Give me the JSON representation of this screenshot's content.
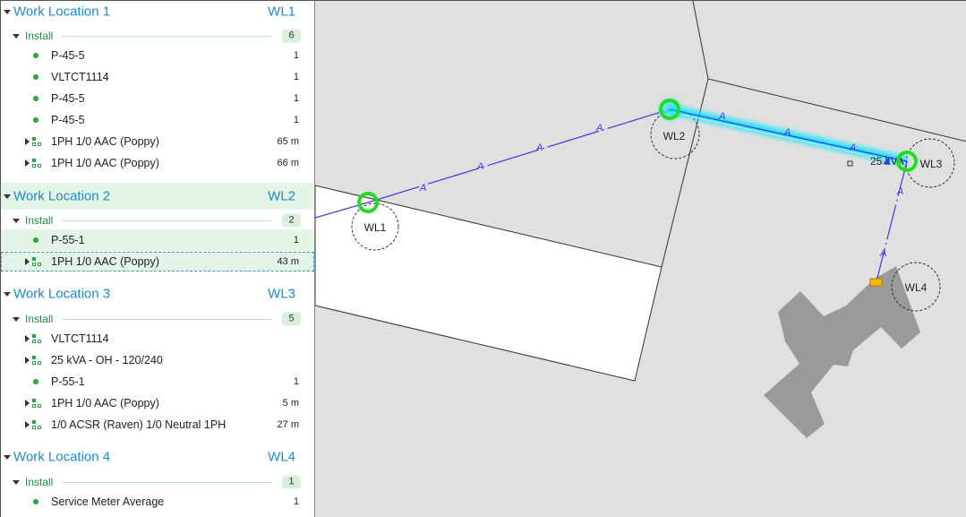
{
  "work_locations": [
    {
      "title": "Work Location 1",
      "code": "WL1",
      "install_label": "Install",
      "install_count": "6",
      "items": [
        {
          "label": "P-45-5",
          "value": "1",
          "kind": "dot"
        },
        {
          "label": "VLTCT1114",
          "value": "1",
          "kind": "dot"
        },
        {
          "label": "P-45-5",
          "value": "1",
          "kind": "dot"
        },
        {
          "label": "P-45-5",
          "value": "1",
          "kind": "dot"
        },
        {
          "label": "1PH 1/0 AAC (Poppy)",
          "value": "65 m",
          "kind": "group"
        },
        {
          "label": "1PH 1/0 AAC (Poppy)",
          "value": "66 m",
          "kind": "group"
        }
      ]
    },
    {
      "title": "Work Location 2",
      "code": "WL2",
      "install_label": "Install",
      "install_count": "2",
      "items": [
        {
          "label": "P-55-1",
          "value": "1",
          "kind": "dot"
        },
        {
          "label": "1PH 1/0 AAC (Poppy)",
          "value": "43 m",
          "kind": "group"
        }
      ]
    },
    {
      "title": "Work Location 3",
      "code": "WL3",
      "install_label": "Install",
      "install_count": "5",
      "items": [
        {
          "label": "VLTCT1114",
          "value": "",
          "kind": "group"
        },
        {
          "label": "25 kVA - OH - 120/240",
          "value": "",
          "kind": "group"
        },
        {
          "label": "P-55-1",
          "value": "1",
          "kind": "dot"
        },
        {
          "label": "1PH 1/0 AAC (Poppy)",
          "value": "5 m",
          "kind": "group"
        },
        {
          "label": "1/0 ACSR (Raven) 1/0 Neutral 1PH",
          "value": "27 m",
          "kind": "group"
        }
      ]
    },
    {
      "title": "Work Location 4",
      "code": "WL4",
      "install_label": "Install",
      "install_count": "1",
      "items": [
        {
          "label": "Service Meter Average",
          "value": "1",
          "kind": "dot"
        }
      ]
    }
  ],
  "map": {
    "wl_labels": [
      "WL1",
      "WL2",
      "WL3",
      "WL4"
    ],
    "transformer_label": "25 kVA",
    "span_marker": "A"
  },
  "colors": {
    "accent_blue": "#1e8ac8",
    "install_green": "#1a8f3a",
    "highlight_bg": "#e3f5e6",
    "conductor": "#3a3ae6",
    "selection_glow": "#00e5ff",
    "pole_ring": "#22dd22",
    "meter": "#f5b800",
    "building": "#9a9a9a"
  }
}
